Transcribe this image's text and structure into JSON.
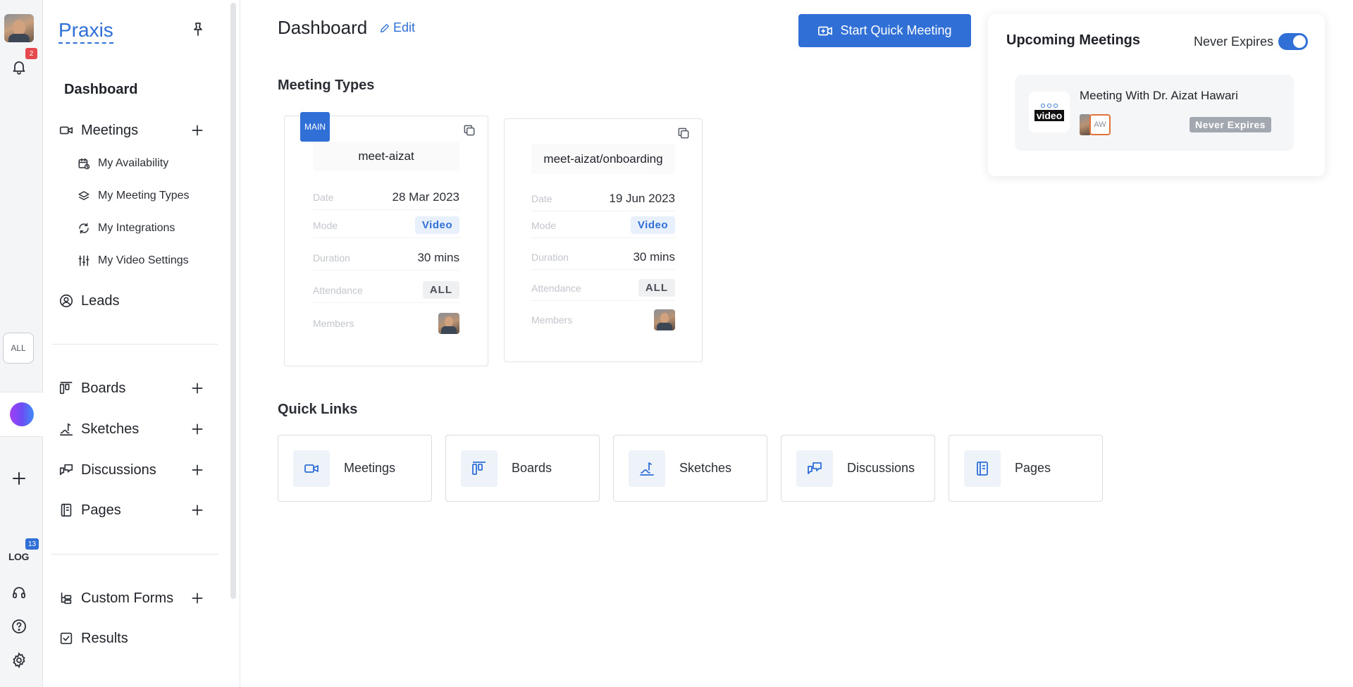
{
  "rail": {
    "notification_count": "2",
    "all_label": "ALL",
    "log_label": "LOG",
    "log_count": "13",
    "icons": [
      "bell-icon",
      "plus-icon",
      "headset-icon",
      "help-icon",
      "settings-icon"
    ]
  },
  "sidebar": {
    "brand": "Praxis",
    "dashboard_label": "Dashboard",
    "meetings_label": "Meetings",
    "sub_items": [
      {
        "label": "My Availability",
        "icon": "calendar-clock-icon"
      },
      {
        "label": "My Meeting Types",
        "icon": "layers-icon"
      },
      {
        "label": "My Integrations",
        "icon": "refresh-icon"
      },
      {
        "label": "My Video Settings",
        "icon": "sliders-icon"
      }
    ],
    "leads_label": "Leads",
    "boards_label": "Boards",
    "sketches_label": "Sketches",
    "discussions_label": "Discussions",
    "pages_label": "Pages",
    "custom_forms_label": "Custom Forms",
    "results_label": "Results"
  },
  "header": {
    "title": "Dashboard",
    "edit_label": "Edit",
    "quick_meeting_label": "Start Quick Meeting"
  },
  "meeting_types": {
    "title": "Meeting Types",
    "labels": {
      "date": "Date",
      "mode": "Mode",
      "duration": "Duration",
      "attendance": "Attendance",
      "members": "Members"
    },
    "cards": [
      {
        "tag": "MAIN",
        "slug": "meet-aizat",
        "date": "28 Mar 2023",
        "mode": "Video",
        "duration": "30 mins",
        "attendance": "ALL"
      },
      {
        "slug": "meet-aizat/onboarding",
        "date": "19 Jun 2023",
        "mode": "Video",
        "duration": "30 mins",
        "attendance": "ALL"
      }
    ]
  },
  "quick_links": {
    "title": "Quick Links",
    "items": [
      {
        "label": "Meetings",
        "icon": "video-icon"
      },
      {
        "label": "Boards",
        "icon": "board-icon"
      },
      {
        "label": "Sketches",
        "icon": "sketch-icon"
      },
      {
        "label": "Discussions",
        "icon": "chat-icon"
      },
      {
        "label": "Pages",
        "icon": "page-icon"
      }
    ]
  },
  "upcoming": {
    "title": "Upcoming Meetings",
    "toggle_label": "Never Expires",
    "toggle_on": true,
    "meeting": {
      "logo_text": "video",
      "title": "Meeting With Dr. Aizat Hawari",
      "attendee_initials": "AW",
      "badge": "Never Expires"
    }
  },
  "colors": {
    "accent": "#2f6fd6",
    "notification": "#e5484d",
    "attendee_ring": "#e0723a"
  }
}
